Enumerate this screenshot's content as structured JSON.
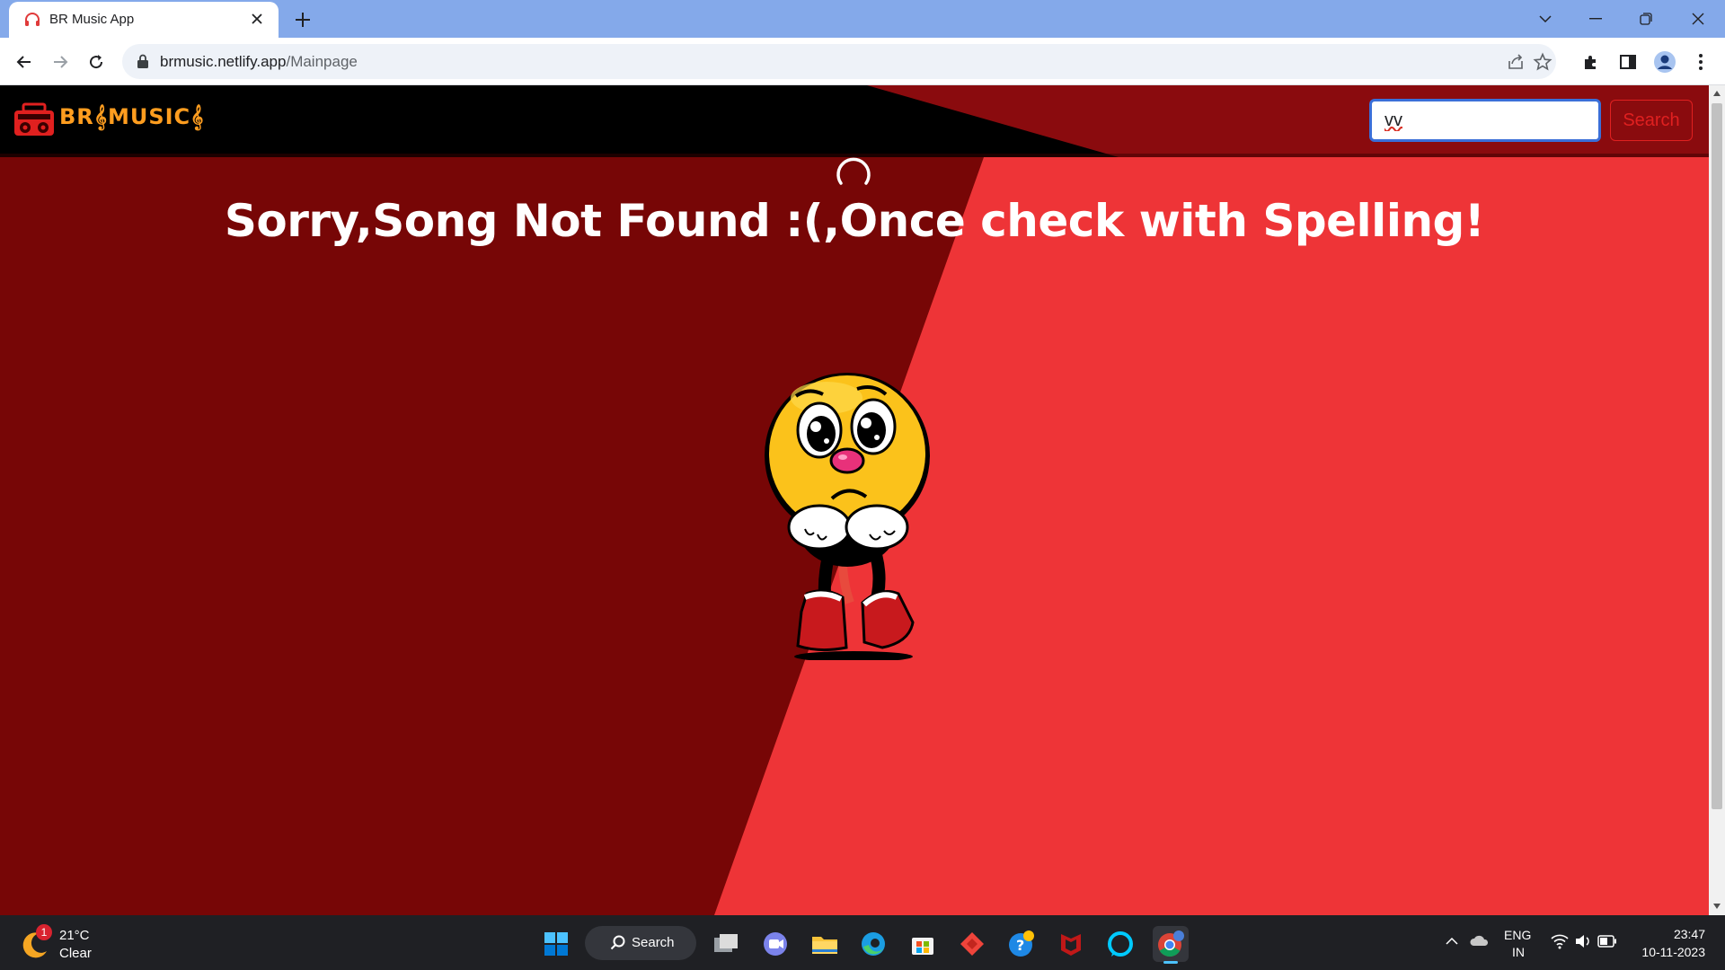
{
  "browser": {
    "tab_title": "BR Music App",
    "url_host": "brmusic.netlify.app",
    "url_path": "/Mainpage"
  },
  "app": {
    "logo_text": "BR𝄞MUSIC𝄞",
    "search_value": "vv",
    "search_button_label": "Search",
    "error_message": "Sorry,Song Not Found :(,Once check with Spelling!",
    "colors": {
      "dark_red": "#770606",
      "bright_red": "#ee3437",
      "navbar_black": "#000000",
      "navbar_red": "#8a0b0e",
      "logo_orange": "#ff9d1f"
    }
  },
  "taskbar": {
    "weather_temp": "21°C",
    "weather_condition": "Clear",
    "weather_badge": "1",
    "search_label": "Search",
    "lang_line1": "ENG",
    "lang_line2": "IN",
    "time": "23:47",
    "date": "10-11-2023"
  }
}
